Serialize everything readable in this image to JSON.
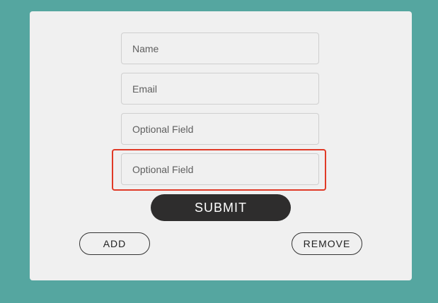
{
  "form": {
    "fields": [
      {
        "placeholder": "Name",
        "value": ""
      },
      {
        "placeholder": "Email",
        "value": ""
      },
      {
        "placeholder": "Optional Field",
        "value": ""
      },
      {
        "placeholder": "Optional Field",
        "value": ""
      }
    ],
    "submit_label": "SUBMIT",
    "add_label": "ADD",
    "remove_label": "REMOVE"
  },
  "colors": {
    "background": "#55a6a0",
    "card": "#f0f0f0",
    "submit_bg": "#2e2d2d",
    "highlight": "#e03a27"
  }
}
